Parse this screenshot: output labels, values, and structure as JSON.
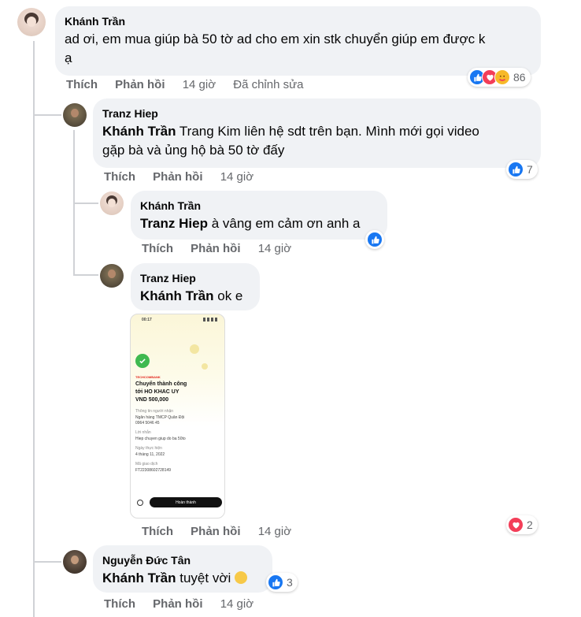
{
  "comments": [
    {
      "author": "Khánh Trần",
      "text": "ad ơi, em mua giúp bà 50 tờ ad cho em xin stk chuyển giúp em được k",
      "text_line2": "ạ",
      "like_label": "Thích",
      "reply_label": "Phản hồi",
      "time": "14 giờ",
      "edited": "Đã chỉnh sửa",
      "reaction_count": "86"
    },
    {
      "author": "Tranz Hiep",
      "mention": "Khánh Trần",
      "text": " Trang Kim liên hệ sdt trên bạn. Mình mới gọi video",
      "text_line2": "gặp bà và ủng hộ bà 50 tờ đấy",
      "like_label": "Thích",
      "reply_label": "Phản hồi",
      "time": "14 giờ",
      "reaction_count": "7"
    },
    {
      "author": "Khánh Trần",
      "mention": "Tranz Hiep",
      "text": " à vâng em cảm ơn anh a",
      "like_label": "Thích",
      "reply_label": "Phản hồi",
      "time": "14 giờ"
    },
    {
      "author": "Tranz Hiep",
      "mention": "Khánh Trần",
      "text": " ok e",
      "like_label": "Thích",
      "reply_label": "Phản hồi",
      "time": "14 giờ",
      "reaction_count": "2",
      "attachment": {
        "status_time": "00:17",
        "bank": "TECHCOMBANK",
        "title1": "Chuyển thành công",
        "title2": "tới HO KHAC UY",
        "amount": "VND 500,000",
        "info_label": "Thông tin người nhận",
        "bank_name": "Ngân hàng TMCP Quân Đội",
        "account": "0964 5046 45",
        "note_label": "Lời nhắn",
        "note": "Hiep chuyen giup do ba 50to",
        "date_label": "Ngày thực hiện",
        "date": "4 tháng 11, 2022",
        "txn_label": "Mã giao dịch",
        "txn": "FT22308602728149",
        "done_button": "Hoàn thành"
      }
    },
    {
      "author": "Nguyễn Đức Tân",
      "mention": "Khánh Trần",
      "text": " tuyệt vời",
      "like_label": "Thích",
      "reply_label": "Phản hồi",
      "time": "14 giờ",
      "reaction_count": "3"
    }
  ],
  "colors": {
    "bubble": "#f0f2f5",
    "meta_text": "#65676b",
    "like_blue": "#1877f2",
    "love_red": "#f33e58"
  }
}
